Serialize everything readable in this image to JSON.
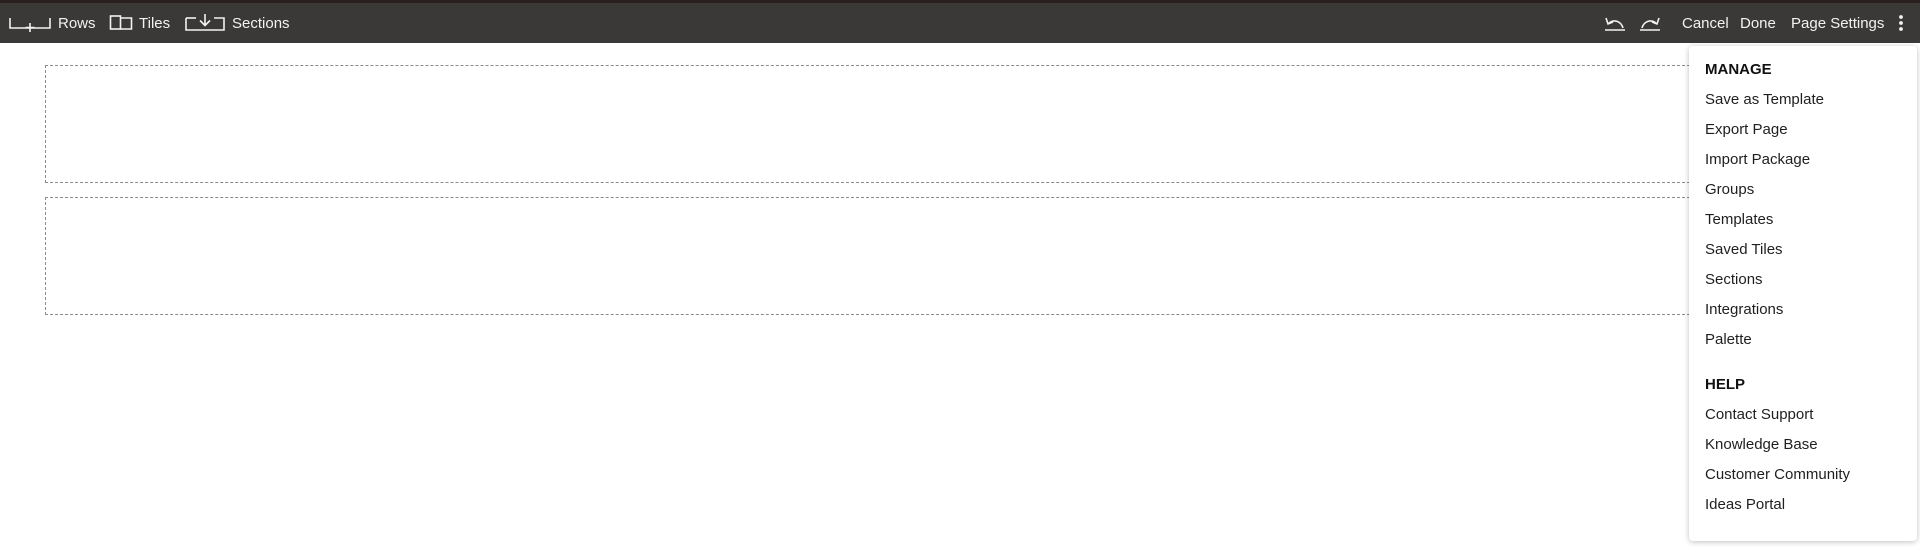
{
  "toolbar": {
    "rows_label": "Rows",
    "tiles_label": "Tiles",
    "sections_label": "Sections",
    "cancel_label": "Cancel",
    "done_label": "Done",
    "page_settings_label": "Page Settings",
    "icons": {
      "rows": "add-row-icon",
      "tiles": "tiles-icon",
      "sections": "import-section-icon",
      "undo": "undo-icon",
      "redo": "redo-icon",
      "more": "more-vertical-icon"
    }
  },
  "menu": {
    "manage_heading": "MANAGE",
    "manage_items": [
      "Save as Template",
      "Export Page",
      "Import Package",
      "Groups",
      "Templates",
      "Saved Tiles",
      "Sections",
      "Integrations",
      "Palette"
    ],
    "help_heading": "HELP",
    "help_items": [
      "Contact Support",
      "Knowledge Base",
      "Customer Community",
      "Ideas Portal"
    ]
  },
  "colors": {
    "toolbar_bg": "#3b3838",
    "toolbar_text": "#f2f2f2",
    "dropzone_border": "#8a8a8a"
  }
}
